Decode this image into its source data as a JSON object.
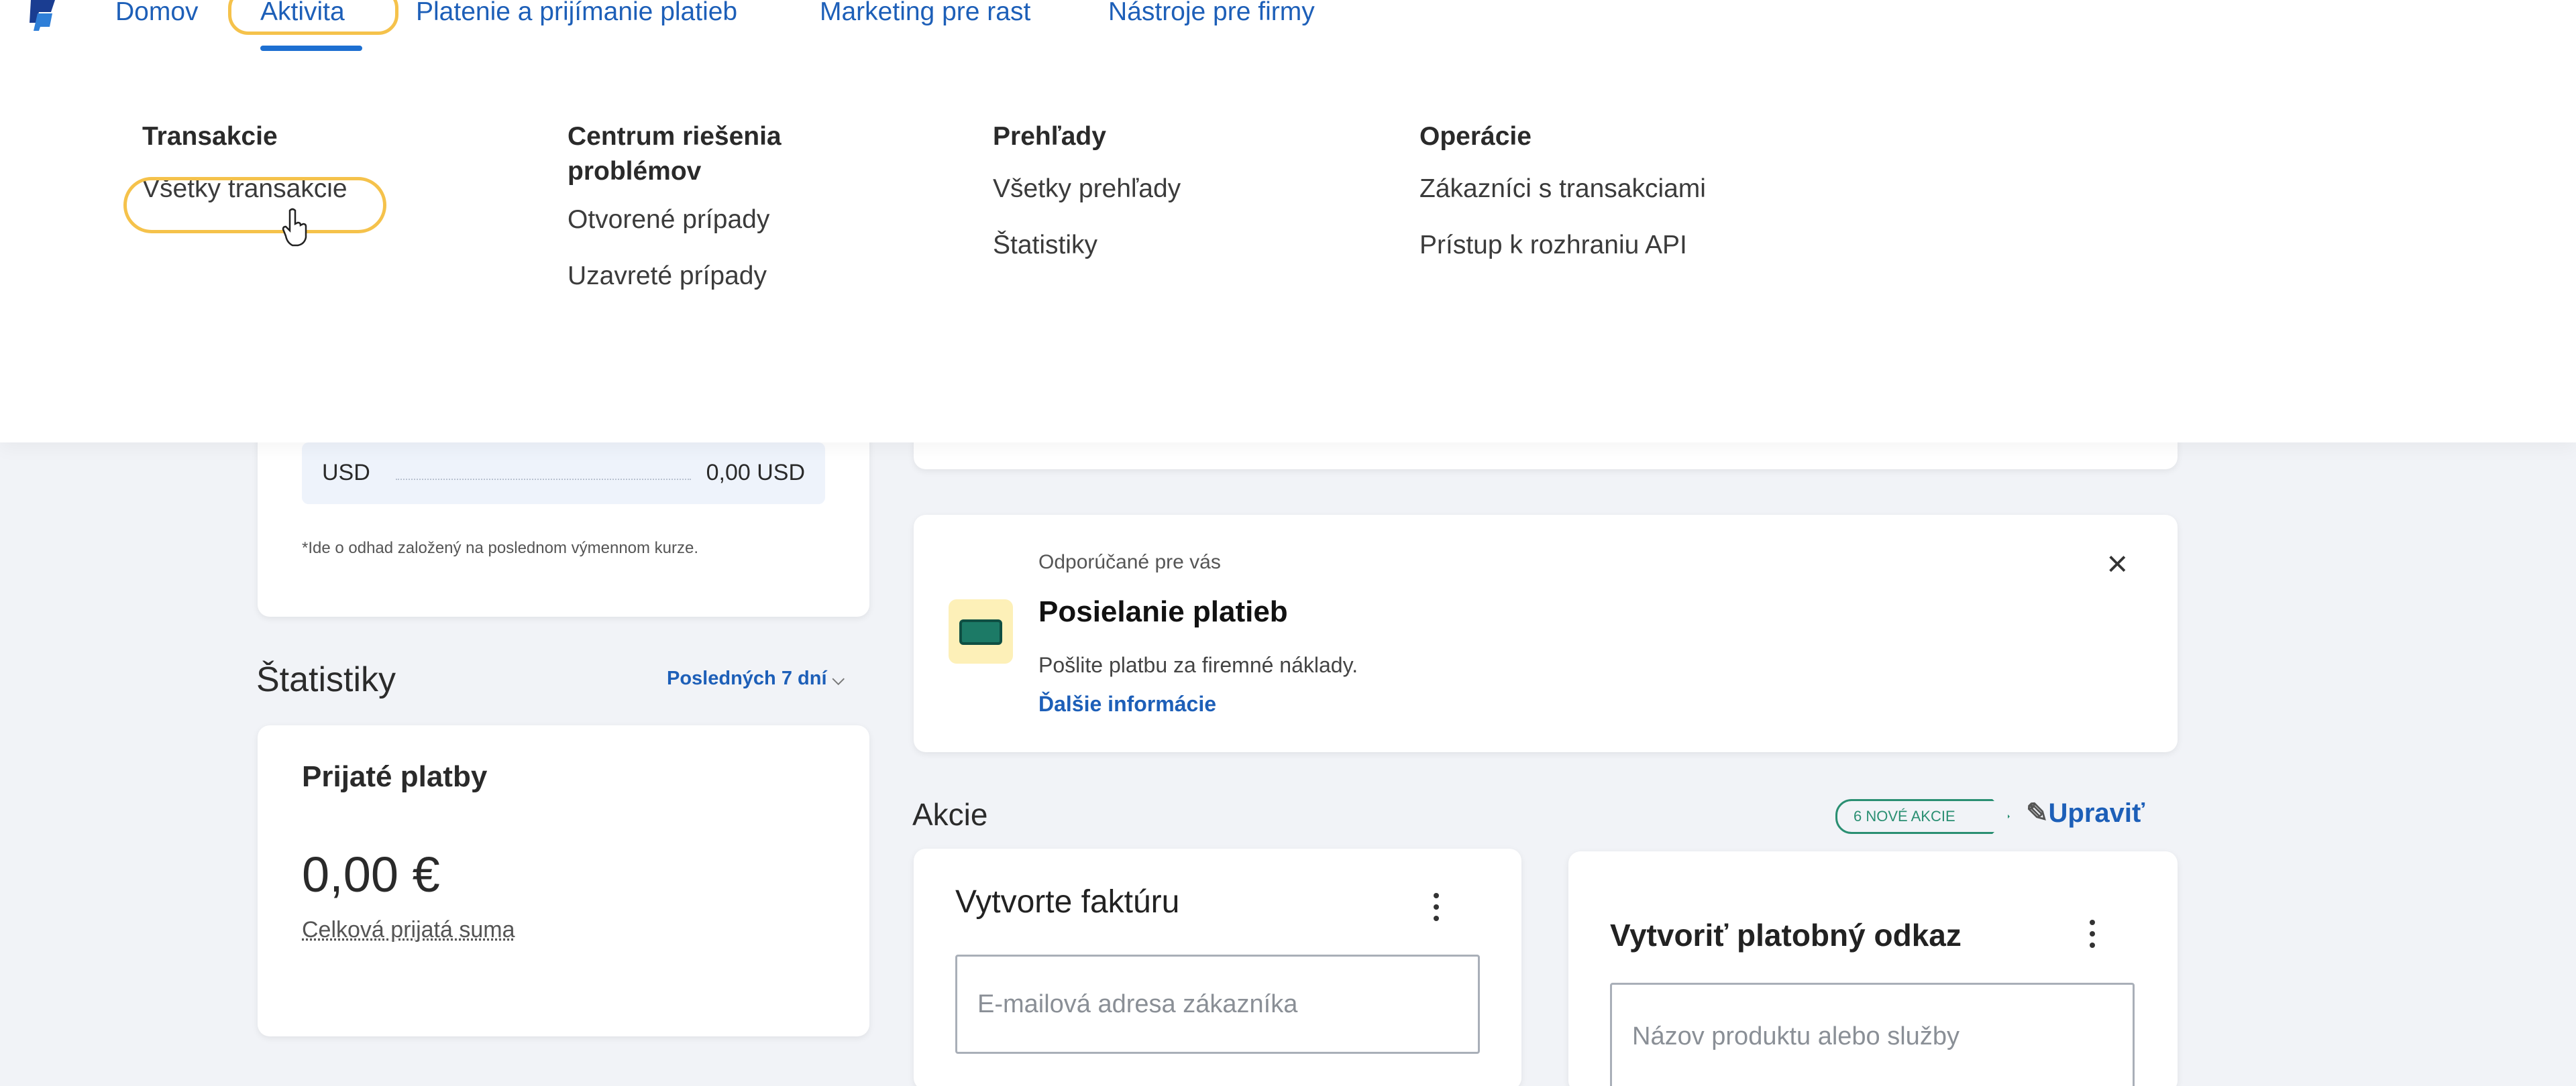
{
  "nav": {
    "items": [
      "Domov",
      "Aktivita",
      "Platenie a prijímanie platieb",
      "Marketing pre rast",
      "Nástroje pre firmy"
    ]
  },
  "menu": {
    "col1": {
      "heading": "Transakcie",
      "links": [
        "Všetky transakcie"
      ]
    },
    "col2": {
      "heading": "Centrum riešenia problémov",
      "links": [
        "Otvorené prípady",
        "Uzavreté prípady"
      ]
    },
    "col3": {
      "heading": "Prehľady",
      "links": [
        "Všetky prehľady",
        "Štatistiky"
      ]
    },
    "col4": {
      "heading": "Operácie",
      "links": [
        "Zákazníci s transakciami",
        "Prístup k rozhraniu API"
      ]
    }
  },
  "balance": {
    "currency": "USD",
    "amount": "0,00 USD",
    "note": "*Ide o odhad založený na poslednom výmennom kurze."
  },
  "stats": {
    "title": "Štatistiky",
    "period": "Posledných 7 dní",
    "card_title": "Prijaté platby",
    "amount": "0,00 €",
    "caption": "Celková prijatá suma"
  },
  "recommend": {
    "label": "Odporúčané pre vás",
    "title": "Posielanie platieb",
    "desc": "Pošlite platbu za firemné náklady.",
    "link": "Ďalšie informácie",
    "close": "×"
  },
  "actions": {
    "title": "Akcie",
    "badge": "6 NOVÉ AKCIE",
    "edit": "Upraviť",
    "invoice": {
      "title": "Vytvorte faktúru",
      "placeholder": "E-mailová adresa zákazníka"
    },
    "paylink": {
      "title": "Vytvoriť platobný odkaz",
      "placeholder": "Názov produktu alebo služby"
    }
  },
  "colors": {
    "accent": "#1d5fb8",
    "highlight": "#f5c24b",
    "badge": "#2a8f72"
  }
}
